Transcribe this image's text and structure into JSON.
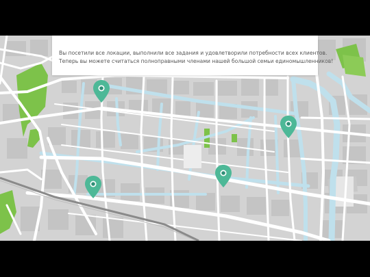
{
  "message": {
    "line1": "Вы посетили все локации, выполнили все задания и удовлетворили потребности всех клиентов.",
    "line2": "Теперь вы можете считаться полноправными членами нашей большой семьи единомышленников!"
  },
  "map": {
    "colors": {
      "background": "#d3d3d3",
      "block": "#c9c9c9",
      "street": "#ffffff",
      "river": "#bfe0ec",
      "park": "#7dc24a",
      "railway": "#8a8a8a",
      "pin": "#4db897",
      "pin_dot": "#ffffff"
    },
    "pins": [
      {
        "name": "location-pin-1",
        "icon": "map-marker-icon"
      },
      {
        "name": "location-pin-2",
        "icon": "map-marker-icon"
      },
      {
        "name": "location-pin-3",
        "icon": "map-marker-icon"
      },
      {
        "name": "location-pin-4",
        "icon": "map-marker-icon"
      },
      {
        "name": "location-pin-5",
        "icon": "map-marker-icon"
      }
    ]
  }
}
